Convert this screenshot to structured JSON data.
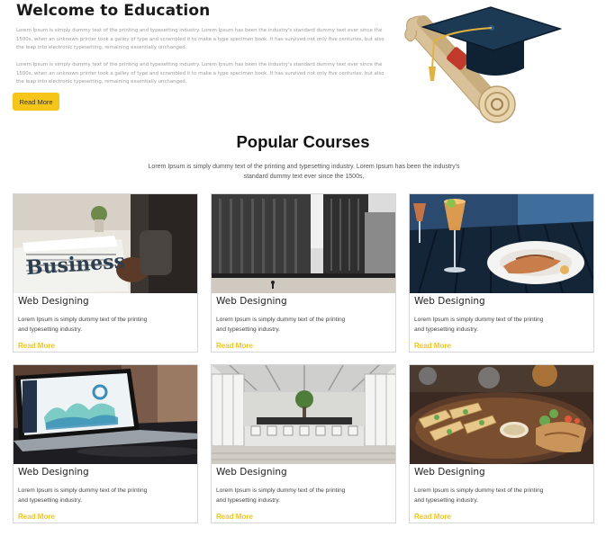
{
  "hero": {
    "title": "Welcome to Education",
    "paragraph_1": "Lorem Ipsum is simply dummy text of the printing and typesetting industry. Lorem Ipsum has been the industry's standard dummy text ever since the 1500s, when an unknown printer took a galley of type and scrambled it to make a type specimen book. It has survived not only five centuries, but also the leap into electronic typesetting, remaining essentially unchanged.",
    "paragraph_2": "Lorem Ipsum is simply dummy text of the printing and typesetting industry. Lorem Ipsum has been the industry's standard dummy text ever since the 1500s, when an unknown printer took a galley of type and scrambled it to make a type specimen book. It has survived not only five centuries, but also the leap into electronic typesetting, remaining essentially unchanged.",
    "button_label": "Read More",
    "illustration_icon": "graduation-cap-diploma-icon"
  },
  "courses": {
    "title": "Popular Courses",
    "subtitle": "Lorem Ipsum is simply dummy text of the printing and typesetting industry. Lorem Ipsum has been the industry's standard dummy text ever since the 1500s,",
    "items": [
      {
        "title": "Web Designing",
        "description": "Lorem Ipsum is simply dummy text of the printing and typesetting industry.",
        "link_label": "Read More",
        "image": "business-newspaper-photo"
      },
      {
        "title": "Web Designing",
        "description": "Lorem Ipsum is simply dummy text of the printing and typesetting industry.",
        "link_label": "Read More",
        "image": "office-buildings-photo"
      },
      {
        "title": "Web Designing",
        "description": "Lorem Ipsum is simply dummy text of the printing and typesetting industry.",
        "link_label": "Read More",
        "image": "restaurant-meal-photo"
      },
      {
        "title": "Web Designing",
        "description": "Lorem Ipsum is simply dummy text of the printing and typesetting industry.",
        "link_label": "Read More",
        "image": "laptop-analytics-photo"
      },
      {
        "title": "Web Designing",
        "description": "Lorem Ipsum is simply dummy text of the printing and typesetting industry.",
        "link_label": "Read More",
        "image": "cafeteria-interior-photo"
      },
      {
        "title": "Web Designing",
        "description": "Lorem Ipsum is simply dummy text of the printing and typesetting industry.",
        "link_label": "Read More",
        "image": "food-platter-photo"
      }
    ]
  },
  "colors": {
    "accent": "#f5c518",
    "heading": "#1a1a1a",
    "muted_text": "#9a9a9a",
    "card_border": "#d6d6d6"
  }
}
